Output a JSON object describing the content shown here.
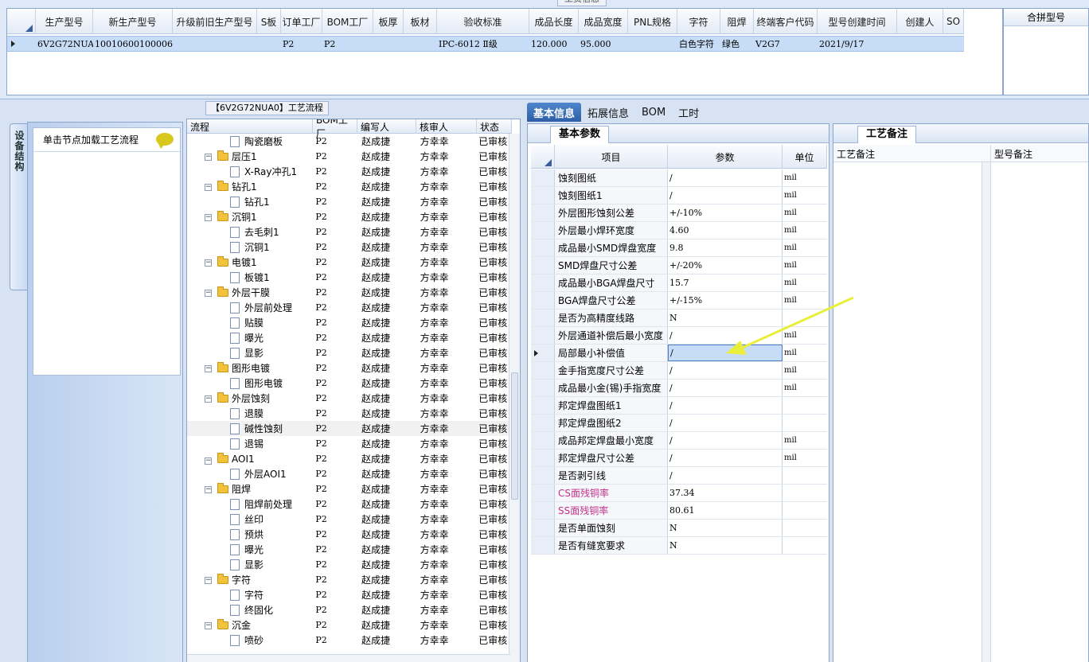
{
  "top": {
    "caption": "工资信息",
    "columns": [
      "生产型号",
      "新生产型号",
      "升级前旧生产型号",
      "S板",
      "订单工厂",
      "BOM工厂",
      "板厚",
      "板材",
      "验收标准",
      "成品长度",
      "成品宽度",
      "PNL规格",
      "字符",
      "阻焊",
      "终端客户代码",
      "型号创建时间",
      "创建人",
      "SO"
    ],
    "row": [
      "6V2G72NUA0",
      "10010600100006",
      "",
      "",
      "P2",
      "P2",
      "",
      "",
      "IPC-6012 Ⅱ级",
      "120.000",
      "95.000",
      "",
      "白色字符",
      "绿色",
      "V2G7",
      "2021/9/17",
      "",
      ""
    ],
    "combine_label": "合拼型号"
  },
  "side": {
    "vtab_label": "设备结构",
    "head_text": "单击节点加载工艺流程"
  },
  "tree": {
    "caption": "【6V2G72NUA0】工艺流程",
    "columns": [
      "流程",
      "BOM工厂",
      "编写人",
      "核审人",
      "状态"
    ],
    "rows": [
      {
        "name": "陶瓷磨板",
        "level": 2,
        "folder": false,
        "bom": "P2",
        "writer": "赵成捷",
        "checker": "方幸幸",
        "state": "已审核"
      },
      {
        "name": "层压1",
        "level": 1,
        "folder": true,
        "bom": "P2",
        "writer": "赵成捷",
        "checker": "方幸幸",
        "state": "已审核"
      },
      {
        "name": "X-Ray冲孔1",
        "level": 2,
        "folder": false,
        "bom": "P2",
        "writer": "赵成捷",
        "checker": "方幸幸",
        "state": "已审核"
      },
      {
        "name": "钻孔1",
        "level": 1,
        "folder": true,
        "bom": "P2",
        "writer": "赵成捷",
        "checker": "方幸幸",
        "state": "已审核"
      },
      {
        "name": "钻孔1",
        "level": 2,
        "folder": false,
        "bom": "P2",
        "writer": "赵成捷",
        "checker": "方幸幸",
        "state": "已审核"
      },
      {
        "name": "沉铜1",
        "level": 1,
        "folder": true,
        "bom": "P2",
        "writer": "赵成捷",
        "checker": "方幸幸",
        "state": "已审核"
      },
      {
        "name": "去毛刺1",
        "level": 2,
        "folder": false,
        "bom": "P2",
        "writer": "赵成捷",
        "checker": "方幸幸",
        "state": "已审核"
      },
      {
        "name": "沉铜1",
        "level": 2,
        "folder": false,
        "bom": "P2",
        "writer": "赵成捷",
        "checker": "方幸幸",
        "state": "已审核"
      },
      {
        "name": "电镀1",
        "level": 1,
        "folder": true,
        "bom": "P2",
        "writer": "赵成捷",
        "checker": "方幸幸",
        "state": "已审核"
      },
      {
        "name": "板镀1",
        "level": 2,
        "folder": false,
        "bom": "P2",
        "writer": "赵成捷",
        "checker": "方幸幸",
        "state": "已审核"
      },
      {
        "name": "外层干膜",
        "level": 1,
        "folder": true,
        "bom": "P2",
        "writer": "赵成捷",
        "checker": "方幸幸",
        "state": "已审核"
      },
      {
        "name": "外层前处理",
        "level": 2,
        "folder": false,
        "bom": "P2",
        "writer": "赵成捷",
        "checker": "方幸幸",
        "state": "已审核"
      },
      {
        "name": "贴膜",
        "level": 2,
        "folder": false,
        "bom": "P2",
        "writer": "赵成捷",
        "checker": "方幸幸",
        "state": "已审核"
      },
      {
        "name": "曝光",
        "level": 2,
        "folder": false,
        "bom": "P2",
        "writer": "赵成捷",
        "checker": "方幸幸",
        "state": "已审核"
      },
      {
        "name": "显影",
        "level": 2,
        "folder": false,
        "bom": "P2",
        "writer": "赵成捷",
        "checker": "方幸幸",
        "state": "已审核"
      },
      {
        "name": "图形电镀",
        "level": 1,
        "folder": true,
        "bom": "P2",
        "writer": "赵成捷",
        "checker": "方幸幸",
        "state": "已审核"
      },
      {
        "name": "图形电镀",
        "level": 2,
        "folder": false,
        "bom": "P2",
        "writer": "赵成捷",
        "checker": "方幸幸",
        "state": "已审核"
      },
      {
        "name": "外层蚀刻",
        "level": 1,
        "folder": true,
        "bom": "P2",
        "writer": "赵成捷",
        "checker": "方幸幸",
        "state": "已审核"
      },
      {
        "name": "退膜",
        "level": 2,
        "folder": false,
        "bom": "P2",
        "writer": "赵成捷",
        "checker": "方幸幸",
        "state": "已审核"
      },
      {
        "name": "碱性蚀刻",
        "level": 2,
        "folder": false,
        "bom": "P2",
        "writer": "赵成捷",
        "checker": "方幸幸",
        "state": "已审核",
        "selected": true
      },
      {
        "name": "退锡",
        "level": 2,
        "folder": false,
        "bom": "P2",
        "writer": "赵成捷",
        "checker": "方幸幸",
        "state": "已审核"
      },
      {
        "name": "AOI1",
        "level": 1,
        "folder": true,
        "bom": "P2",
        "writer": "赵成捷",
        "checker": "方幸幸",
        "state": "已审核"
      },
      {
        "name": "外层AOI1",
        "level": 2,
        "folder": false,
        "bom": "P2",
        "writer": "赵成捷",
        "checker": "方幸幸",
        "state": "已审核"
      },
      {
        "name": "阻焊",
        "level": 1,
        "folder": true,
        "bom": "P2",
        "writer": "赵成捷",
        "checker": "方幸幸",
        "state": "已审核"
      },
      {
        "name": "阻焊前处理",
        "level": 2,
        "folder": false,
        "bom": "P2",
        "writer": "赵成捷",
        "checker": "方幸幸",
        "state": "已审核"
      },
      {
        "name": "丝印",
        "level": 2,
        "folder": false,
        "bom": "P2",
        "writer": "赵成捷",
        "checker": "方幸幸",
        "state": "已审核"
      },
      {
        "name": "预烘",
        "level": 2,
        "folder": false,
        "bom": "P2",
        "writer": "赵成捷",
        "checker": "方幸幸",
        "state": "已审核"
      },
      {
        "name": "曝光",
        "level": 2,
        "folder": false,
        "bom": "P2",
        "writer": "赵成捷",
        "checker": "方幸幸",
        "state": "已审核"
      },
      {
        "name": "显影",
        "level": 2,
        "folder": false,
        "bom": "P2",
        "writer": "赵成捷",
        "checker": "方幸幸",
        "state": "已审核"
      },
      {
        "name": "字符",
        "level": 1,
        "folder": true,
        "bom": "P2",
        "writer": "赵成捷",
        "checker": "方幸幸",
        "state": "已审核"
      },
      {
        "name": "字符",
        "level": 2,
        "folder": false,
        "bom": "P2",
        "writer": "赵成捷",
        "checker": "方幸幸",
        "state": "已审核"
      },
      {
        "name": "终固化",
        "level": 2,
        "folder": false,
        "bom": "P2",
        "writer": "赵成捷",
        "checker": "方幸幸",
        "state": "已审核"
      },
      {
        "name": "沉金",
        "level": 1,
        "folder": true,
        "bom": "P2",
        "writer": "赵成捷",
        "checker": "方幸幸",
        "state": "已审核"
      },
      {
        "name": "喷砂",
        "level": 2,
        "folder": false,
        "bom": "P2",
        "writer": "赵成捷",
        "checker": "方幸幸",
        "state": "已审核"
      }
    ]
  },
  "right_tabs": [
    "基本信息",
    "拓展信息",
    "BOM",
    "工时"
  ],
  "params": {
    "tab_label": "基本参数",
    "columns": [
      "项目",
      "参数",
      "单位"
    ],
    "rows": [
      {
        "item": "蚀刻图纸",
        "value": "/",
        "unit": "mil"
      },
      {
        "item": "蚀刻图纸1",
        "value": "/",
        "unit": "mil"
      },
      {
        "item": "外层图形蚀刻公差",
        "value": "+/-10%",
        "unit": "mil"
      },
      {
        "item": "外层最小焊环宽度",
        "value": "4.60",
        "unit": "mil"
      },
      {
        "item": "成品最小SMD焊盘宽度",
        "value": "9.8",
        "unit": "mil"
      },
      {
        "item": "SMD焊盘尺寸公差",
        "value": "+/-20%",
        "unit": "mil"
      },
      {
        "item": "成品最小BGA焊盘尺寸",
        "value": "15.7",
        "unit": "mil"
      },
      {
        "item": "BGA焊盘尺寸公差",
        "value": "+/-15%",
        "unit": "mil"
      },
      {
        "item": "是否为高精度线路",
        "value": "N",
        "unit": ""
      },
      {
        "item": "外层通道补偿后最小宽度",
        "value": "/",
        "unit": "mil"
      },
      {
        "item": "局部最小补偿值",
        "value": "/",
        "unit": "mil",
        "current": true
      },
      {
        "item": "金手指宽度尺寸公差",
        "value": "/",
        "unit": "mil"
      },
      {
        "item": "成品最小金(锡)手指宽度",
        "value": "/",
        "unit": "mil"
      },
      {
        "item": "邦定焊盘图纸1",
        "value": "/",
        "unit": ""
      },
      {
        "item": "邦定焊盘图纸2",
        "value": "/",
        "unit": ""
      },
      {
        "item": "成品邦定焊盘最小宽度",
        "value": "/",
        "unit": "mil"
      },
      {
        "item": "邦定焊盘尺寸公差",
        "value": "/",
        "unit": "mil"
      },
      {
        "item": "是否剥引线",
        "value": "/",
        "unit": ""
      },
      {
        "item": "CS面残铜率",
        "value": "37.34",
        "unit": "",
        "pink": true
      },
      {
        "item": "SS面残铜率",
        "value": "80.61",
        "unit": "",
        "pink": true
      },
      {
        "item": "是否单面蚀刻",
        "value": "N",
        "unit": ""
      },
      {
        "item": "是否有缝宽要求",
        "value": "N",
        "unit": ""
      }
    ]
  },
  "notes": {
    "tab_label": "工艺备注",
    "columns": [
      "工艺备注",
      "型号备注"
    ]
  },
  "colors": {
    "accent": "#2d5fa6",
    "selection": "#c7dcf6",
    "pink_text": "#c0338b",
    "arrow": "#e8ee3a"
  }
}
